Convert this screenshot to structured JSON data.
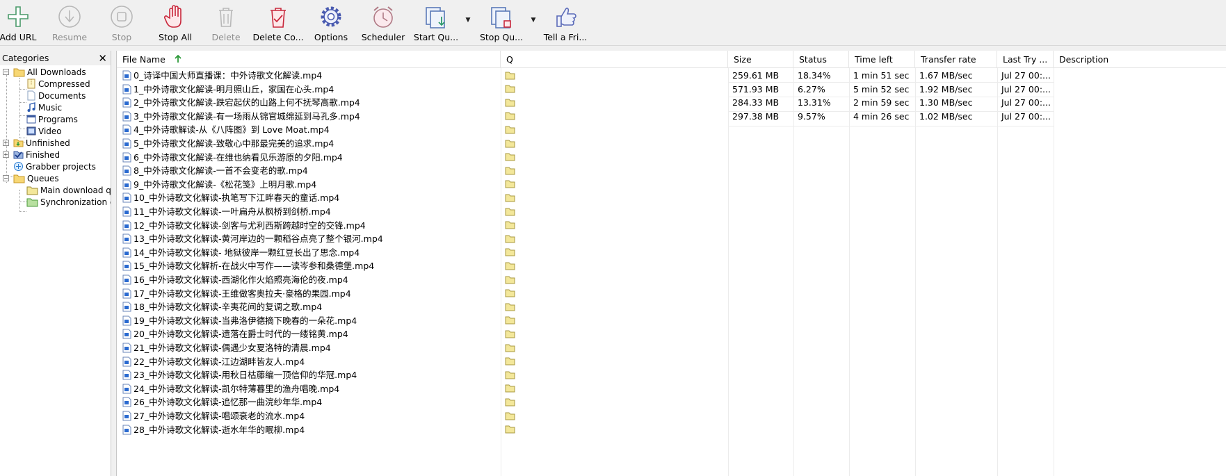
{
  "toolbar": {
    "add_url": "Add URL",
    "resume": "Resume",
    "stop": "Stop",
    "stop_all": "Stop All",
    "delete": "Delete",
    "delete_completed": "Delete Co...",
    "options": "Options",
    "scheduler": "Scheduler",
    "start_queue": "Start Qu...",
    "stop_queue": "Stop Qu...",
    "tell_friend": "Tell a Fri..."
  },
  "categories": {
    "title": "Categories",
    "close": "✕",
    "all_downloads": "All Downloads",
    "compressed": "Compressed",
    "documents": "Documents",
    "music": "Music",
    "programs": "Programs",
    "video": "Video",
    "unfinished": "Unfinished",
    "finished": "Finished",
    "grabber_projects": "Grabber projects",
    "queues": "Queues",
    "main_queue": "Main download qu",
    "sync_queue": "Synchronization q"
  },
  "columns": {
    "file_name": "File Name",
    "q": "Q",
    "size": "Size",
    "status": "Status",
    "time_left": "Time left",
    "transfer_rate": "Transfer rate",
    "last_try": "Last Try ...",
    "description": "Description"
  },
  "rows": [
    {
      "name": "0_诗译中国大师直播课：中外诗歌文化解读.mp4",
      "size": "259.61  MB",
      "status": "18.34%",
      "time_left": "1 min 51 sec",
      "rate": "1.67  MB/sec",
      "last_try": "Jul 27 00:..."
    },
    {
      "name": "1_中外诗歌文化解读-明月照山丘，家国在心头.mp4",
      "size": "571.93  MB",
      "status": "6.27%",
      "time_left": "5 min 52 sec",
      "rate": "1.92  MB/sec",
      "last_try": "Jul 27 00:..."
    },
    {
      "name": "2_中外诗歌文化解读-跌宕起伏的山路上何不抚琴高歌.mp4",
      "size": "284.33  MB",
      "status": "13.31%",
      "time_left": "2 min 59 sec",
      "rate": "1.30  MB/sec",
      "last_try": "Jul 27 00:..."
    },
    {
      "name": "3_中外诗歌文化解读-有一场雨从锦官城绵延到马孔多.mp4",
      "size": "297.38  MB",
      "status": "9.57%",
      "time_left": "4 min 26 sec",
      "rate": "1.02  MB/sec",
      "last_try": "Jul 27 00:..."
    },
    {
      "name": "4_中外诗歌解读-从《八阵图》到 Love Moat.mp4"
    },
    {
      "name": "5_中外诗歌文化解读-致敬心中那最完美的追求.mp4"
    },
    {
      "name": "6_中外诗歌文化解读-在维也纳看见乐游原的夕阳.mp4"
    },
    {
      "name": "8_中外诗歌文化解读-一首不会变老的歌.mp4"
    },
    {
      "name": "9_中外诗歌文化解读-《松花笺》上明月歌.mp4"
    },
    {
      "name": "10_中外诗歌文化解读-执笔写下江畔春天的童话.mp4"
    },
    {
      "name": "11_中外诗歌文化解读-一叶扁舟从枫桥到剑桥.mp4"
    },
    {
      "name": "12_中外诗歌文化解读-剑客与尤利西斯跨越时空的交锋.mp4"
    },
    {
      "name": "13_中外诗歌文化解读-黄河岸边的一颗稻谷点亮了整个银河.mp4"
    },
    {
      "name": "14_中外诗歌文化解读- 地狱彼岸一颗红豆长出了思念.mp4"
    },
    {
      "name": "15_中外诗歌文化解析-在战火中写作——读岑参和桑德堡.mp4"
    },
    {
      "name": "16_中外诗歌文化解读-西湖化作火焰照亮海伦的夜.mp4"
    },
    {
      "name": "17_中外诗歌文化解读-王维做客奥拉夫·豪格的果园.mp4"
    },
    {
      "name": "18_中外诗歌文化解读-辛夷花间的复调之歌.mp4"
    },
    {
      "name": "19_中外诗歌文化解读-当弗洛伊德摘下晚春的一朵花.mp4"
    },
    {
      "name": "20_中外诗歌文化解读-遗落在爵士时代的一缕铭黄.mp4"
    },
    {
      "name": "21_中外诗歌文化解读-偶遇少女夏洛特的清晨.mp4"
    },
    {
      "name": "22_中外诗歌文化解读-江边湖畔皆友人.mp4"
    },
    {
      "name": "23_中外诗歌文化解读-用秋日枯藤编一顶信仰的华冠.mp4"
    },
    {
      "name": "24_中外诗歌文化解读-凯尔特薄暮里的渔舟唱晚.mp4"
    },
    {
      "name": "26_中外诗歌文化解读-追忆那一曲浣纱年华.mp4"
    },
    {
      "name": "27_中外诗歌文化解读-唱颂衰老的流水.mp4"
    },
    {
      "name": "28_中外诗歌文化解读-逝水年华的眠柳.mp4"
    }
  ]
}
